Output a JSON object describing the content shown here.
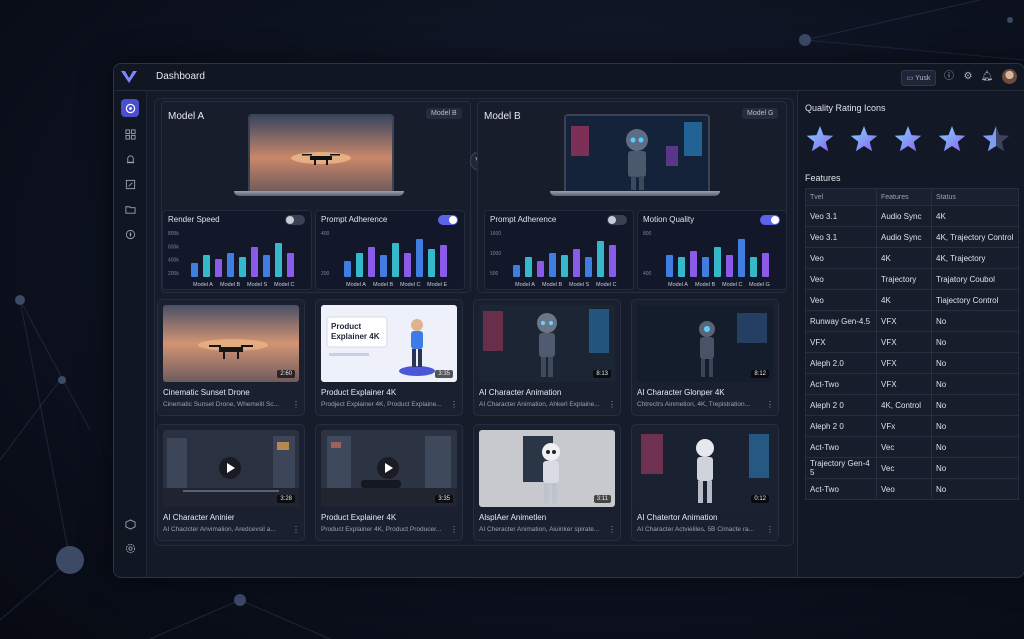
{
  "header": {
    "title": "Dashboard",
    "yusk_label": "Yusk"
  },
  "compare": {
    "left": {
      "label": "Model A",
      "badge": "Model B"
    },
    "right": {
      "label": "Model B",
      "badge": "Model G"
    },
    "vs": "VS"
  },
  "metrics": [
    {
      "title": "Render Speed",
      "toggle": "off",
      "yticks": [
        "800k",
        "600k",
        "400k",
        "200k"
      ],
      "xlabels": [
        "Model A",
        "Model B",
        "Model S",
        "Model C"
      ],
      "values": [
        0.35,
        0.55,
        0.45,
        0.6,
        0.5,
        0.75,
        0.55,
        0.85,
        0.6
      ]
    },
    {
      "title": "Prompt Adherence",
      "toggle": "on",
      "yticks": [
        "400",
        "200"
      ],
      "xlabels": [
        "Model A",
        "Model B",
        "Model C",
        "Model E"
      ],
      "values": [
        0.4,
        0.6,
        0.75,
        0.55,
        0.85,
        0.6,
        0.95,
        0.7,
        0.8
      ]
    },
    {
      "title": "Prompt Adherence",
      "toggle": "off",
      "yticks": [
        "1600",
        "1000",
        "500"
      ],
      "xlabels": [
        "Model A",
        "Model B",
        "Model S",
        "Model C"
      ],
      "values": [
        0.3,
        0.5,
        0.4,
        0.6,
        0.55,
        0.7,
        0.5,
        0.9,
        0.8
      ]
    },
    {
      "title": "Motion Quality",
      "toggle": "on",
      "yticks": [
        "800",
        "400"
      ],
      "xlabels": [
        "Model A",
        "Model B",
        "Model C",
        "Model G"
      ],
      "values": [
        0.55,
        0.5,
        0.65,
        0.5,
        0.75,
        0.55,
        0.95,
        0.5,
        0.6
      ]
    }
  ],
  "cards": [
    {
      "title": "Cinematic Sunset Drone",
      "sub": "Cinematic Sunset Drone, Whemelit Sc...",
      "dur": "2:60",
      "scene": "sunset"
    },
    {
      "title": "Product Explainer 4K",
      "sub": "Prodject Explainer 4K, Product Explaine...",
      "dur": "3:35",
      "scene": "explainer",
      "overlay": "Product Explainer 4K"
    },
    {
      "title": "AI Character Animation",
      "sub": "AI Character Animation, Ahkerl Explaine...",
      "dur": "8:13",
      "scene": "robot"
    },
    {
      "title": "AI Character Glonper 4K",
      "sub": "Chtrectrs Ainmetion, 4K, Trepistration...",
      "dur": "8:12",
      "scene": "robot2"
    },
    {
      "title": "AI Character Aninier",
      "sub": "AI Chaclcter Anvimalion, Aredcevsil a...",
      "dur": "3:28",
      "scene": "city"
    },
    {
      "title": "Product Explainer 4K",
      "sub": "Product Explainer 4K, Product Producer...",
      "dur": "3:35",
      "scene": "city2"
    },
    {
      "title": "AlsplAer Animetlen",
      "sub": "AI Cheracter Animation, Aiuinker spirate...",
      "dur": "3:11",
      "scene": "robot3"
    },
    {
      "title": "AI Chatertor Animation",
      "sub": "AI Character Actvieliles, 5B Cimacte ra...",
      "dur": "0:12",
      "scene": "robot4"
    }
  ],
  "right": {
    "rating_title": "Quality Rating Icons",
    "features_title": "Features",
    "columns": [
      "Tvel",
      "Features",
      "Status"
    ],
    "rows": [
      [
        "Veo 3.1",
        "Audio Sync",
        "4K"
      ],
      [
        "Veo 3.1",
        "Audio Sync",
        "4K, Trajectory Control"
      ],
      [
        "Veo",
        "4K",
        "4K, Trajectory"
      ],
      [
        "Veo",
        "Trajectory",
        "Trajatory Coubol"
      ],
      [
        "Veo",
        "4K",
        "Tiajectory Control"
      ],
      [
        "Runway Gen-4.5",
        "VFX",
        "No"
      ],
      [
        "VFX",
        "VFX",
        "No"
      ],
      [
        "Aleph 2.0",
        "VFX",
        "No"
      ],
      [
        "Act-Two",
        "VFX",
        "No"
      ],
      [
        "Aleph 2 0",
        "4K, Control",
        "No"
      ],
      [
        "Aleph 2 0",
        "VFx",
        "No"
      ],
      [
        "Act-Two",
        "Vec",
        "No"
      ],
      [
        "Trajectory Gen-4 5",
        "Vec",
        "No"
      ],
      [
        "Act-Two",
        "Veo",
        "No"
      ]
    ]
  },
  "colors": {
    "accent": "#5b63e8",
    "bar_blue": "#3f7de0",
    "bar_cyan": "#35b8c9",
    "bar_purple": "#8a5be8"
  }
}
